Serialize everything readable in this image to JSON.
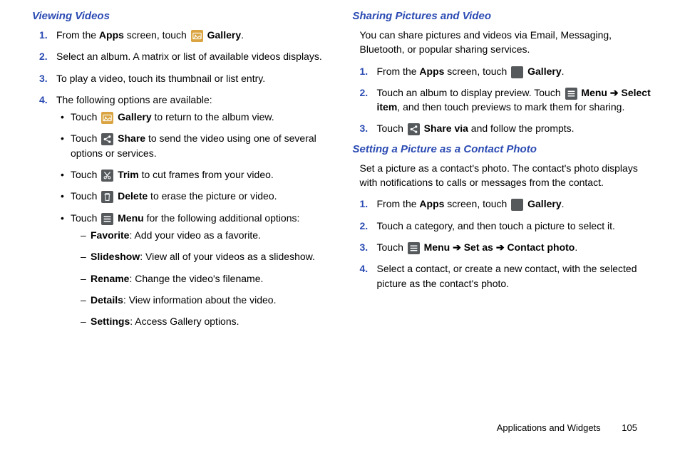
{
  "left": {
    "h1": "Viewing Videos",
    "s1a": "From the ",
    "s1b": "Apps",
    "s1c": " screen, touch ",
    "s1d": "Gallery",
    "s1e": ".",
    "s2": "Select an album. A matrix or list of available videos displays.",
    "s3": "To play a video, touch its thumbnail or list entry.",
    "s4": "The following options are available:",
    "b1a": "Touch ",
    "b1b": "Gallery",
    "b1c": " to return to the album view.",
    "b2a": "Touch ",
    "b2b": "Share",
    "b2c": " to send the video using one of several options or services.",
    "b3a": "Touch ",
    "b3b": "Trim",
    "b3c": " to cut frames from your video.",
    "b4a": "Touch ",
    "b4b": "Delete",
    "b4c": " to erase the picture or video.",
    "b5a": "Touch ",
    "b5b": "Menu",
    "b5c": " for the following additional options:",
    "d1a": "Favorite",
    "d1b": ": Add your video as a favorite.",
    "d2a": "Slideshow",
    "d2b": ": View all of your videos as a slideshow.",
    "d3a": "Rename",
    "d3b": ": Change the video's filename.",
    "d4a": "Details",
    "d4b": ": View information about the video.",
    "d5a": "Settings",
    "d5b": ": Access Gallery options."
  },
  "right": {
    "h1": "Sharing Pictures and Video",
    "intro1": "You can share pictures and videos via Email, Messaging, Bluetooth, or popular sharing services.",
    "s1a": "From the ",
    "s1b": "Apps",
    "s1c": " screen, touch ",
    "s1d": "Gallery",
    "s1e": ".",
    "s2a": "Touch an album to display preview. Touch ",
    "s2b": "Menu",
    "s2c": " ",
    "s2arr": "➔",
    "s2d": " Select item",
    "s2e": ", and then touch previews to mark them for sharing.",
    "s3a": "Touch ",
    "s3b": "Share via",
    "s3c": " and follow the prompts.",
    "h2": "Setting a Picture as a Contact Photo",
    "intro2": "Set a picture as a contact's photo. The contact's photo displays with notifications to calls or messages from the contact.",
    "c1a": "From the ",
    "c1b": "Apps",
    "c1c": " screen, touch ",
    "c1d": "Gallery",
    "c1e": ".",
    "c2": "Touch a category, and then touch a picture to select it.",
    "c3a": "Touch ",
    "c3b": "Menu",
    "c3arr1": " ➔ ",
    "c3c": "Set as",
    "c3arr2": " ➔ ",
    "c3d": "Contact photo",
    "c3e": ".",
    "c4": "Select a contact, or create a new contact, with the selected picture as the contact's photo."
  },
  "footer": {
    "section": "Applications and Widgets",
    "page": "105"
  }
}
